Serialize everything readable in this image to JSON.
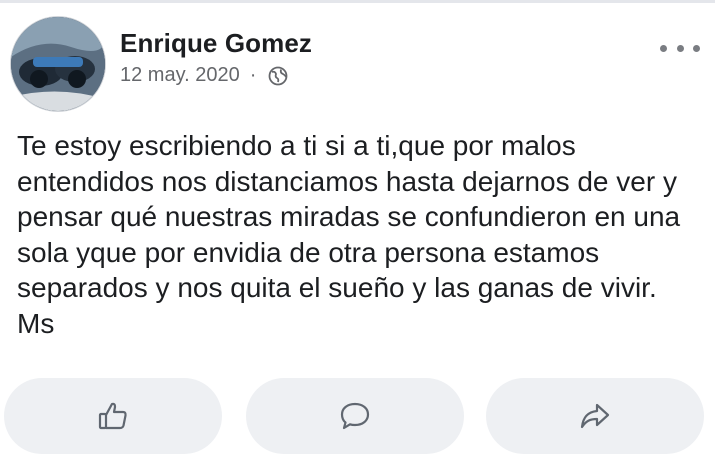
{
  "post": {
    "author": "Enrique Gomez",
    "date": "12 may. 2020",
    "separator": "·",
    "privacy_icon": "globe-icon",
    "text": "Te estoy escribiendo a ti si a ti,que por malos entendidos nos distanciamos hasta dejarnos de ver y pensar qué nuestras miradas se confundieron en una sola yque por envidia de otra persona estamos separados y nos quita el sueño y las ganas de vivir. Ms"
  },
  "actions": {
    "like_icon": "thumbs-up-icon",
    "comment_icon": "comment-icon",
    "share_icon": "share-icon"
  },
  "colors": {
    "text": "#1c1e21",
    "secondary_text": "#65676b",
    "button_bg": "#eef0f3",
    "icon": "#606770"
  }
}
